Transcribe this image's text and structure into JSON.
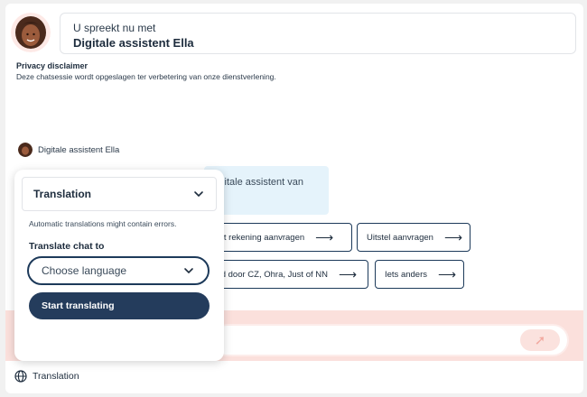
{
  "header": {
    "subtitle": "U spreekt nu met",
    "agent_name": "Digitale assistent Ella",
    "avatar": "woman-avatar"
  },
  "privacy": {
    "title": "Privacy disclaimer",
    "text": "Deze chatsessie wordt opgeslagen ter verbetering van onze dienstverlening."
  },
  "conversation": {
    "sender": "Digitale assistent Ella",
    "message_visible_text": "igitale assistent van"
  },
  "quick_replies": [
    {
      "label": "zicht rekening aanvragen",
      "icon": "arrow-right-icon"
    },
    {
      "label": "Uitstel aanvragen",
      "icon": "arrow-right-icon"
    },
    {
      "label": "roed door CZ, Ohra, Just of NN",
      "icon": "arrow-right-icon"
    },
    {
      "label": "Iets anders",
      "icon": "arrow-right-icon"
    }
  ],
  "composer": {
    "send_icon": "send-arrow-icon"
  },
  "translation_popup": {
    "title": "Translation",
    "note": "Automatic translations might contain errors.",
    "translate_label": "Translate chat to",
    "language_placeholder": "Choose language",
    "start_button": "Start translating"
  },
  "footer": {
    "label": "Translation",
    "icon": "globe-icon"
  },
  "colors": {
    "brand_dark": "#243c5c",
    "composer_band": "#fbe0dc",
    "bubble": "#e5f3fb",
    "send_icon": "#f2a9a0"
  }
}
